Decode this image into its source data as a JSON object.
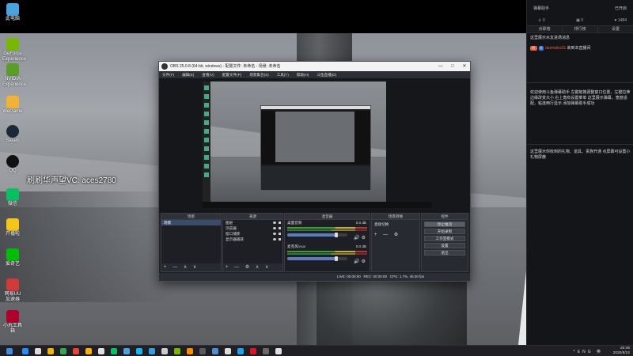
{
  "desktop": {
    "icons": [
      {
        "label": "此电脑",
        "color": "#4aa3df"
      },
      {
        "label": "GeForce Experience",
        "color": "#76b900"
      },
      {
        "label": "NVIDIA Experience",
        "color": "#5a9e2a"
      },
      {
        "label": "WeGame",
        "color": "#f2b233"
      },
      {
        "label": "Steam",
        "color": "#1b2838"
      },
      {
        "label": "QQ",
        "color": "#111111"
      },
      {
        "label": "微信",
        "color": "#07c160"
      },
      {
        "label": "开播啦",
        "color": "#f5c518"
      },
      {
        "label": "爱奇艺",
        "color": "#00be06"
      },
      {
        "label": "网易UU加速器",
        "color": "#d23a3a"
      },
      {
        "label": "小丸工具箱",
        "color": "#b0002a"
      }
    ],
    "overlay_text": "刷刷华声望VC: aces2780"
  },
  "side_panel": {
    "title": "弹幕助手",
    "status": "已开启",
    "stats": [
      {
        "icon": "person-icon",
        "value": "0"
      },
      {
        "icon": "gift-icon",
        "value": "0"
      },
      {
        "icon": "heart-icon",
        "value": "1484"
      }
    ],
    "tabs": [
      "点歌墙",
      "排行榜",
      "设置"
    ],
    "messages": [
      {
        "text": "这里展示水友进场消息"
      },
      {
        "badges": [
          "粉",
          "8"
        ],
        "user": "danmaku01",
        "text": "来到本直播间"
      },
      {
        "text": "欢迎使用斗鱼弹幕助手 左键拖拽调整窗口位置，左键拉伸边缘改变大小 右上角有设置菜单 这里展示弹幕，宽度适配，粘连两行显示 添加弹幕助手成功"
      },
      {
        "text": "这里展示你收到的礼物、道具、贵族开通 点屏幕可设置小礼物屏蔽"
      }
    ]
  },
  "obs": {
    "title": "OBS 25.0.8 (64-bit, windows) - 配置文件: 未命名 - 场景: 未命名",
    "window_buttons": [
      "—",
      "□",
      "✕"
    ],
    "menu": [
      "文件(F)",
      "编辑(E)",
      "查看(V)",
      "配置文件(P)",
      "场景集合(S)",
      "工具(T)",
      "帮助(H)",
      "斗鱼直播(D)"
    ],
    "docks": {
      "scenes": {
        "title": "场景",
        "items": [
          "场景"
        ],
        "footer": "+ — ∧ ∨"
      },
      "sources": {
        "title": "来源",
        "items": [
          "图层",
          "浏览器",
          "窗口捕获",
          "显示器捕获"
        ],
        "footer": "+ — ⚙ ∧ ∨"
      },
      "mixer": {
        "title": "混音器",
        "channels": [
          {
            "name": "桌面音频",
            "db": "0.0 dB",
            "level": 0.82
          },
          {
            "name": "麦克风/Aux",
            "db": "0.0 dB",
            "level": 0.82
          }
        ]
      },
      "transitions": {
        "title": "场景转换",
        "type": "直接切换",
        "footer": "+ — ⚙"
      },
      "controls": {
        "title": "控件",
        "buttons": [
          "停止推流",
          "开始录制",
          "工作室模式",
          "设置",
          "退出"
        ]
      }
    },
    "status_bar": {
      "live": "LIVE: 00:00:00",
      "rec": "REC: 00:00:00",
      "cpu": "CPU: 1.7%, 45.00 fps"
    }
  },
  "taskbar": {
    "pinned_colors": [
      "#1e90ff",
      "#dddddd",
      "#f4b400",
      "#34a853",
      "#ea4335",
      "#ffb300",
      "#e0e0e0",
      "#07c160",
      "#4aa3df",
      "#12b7f5",
      "#2f9fe8",
      "#cccccc",
      "#76b900",
      "#ff8c00",
      "#5b5b5b",
      "#4a8fd8",
      "#dddddd",
      "#1da1f2",
      "#e81123",
      "#6a6a6a",
      "#e0e0e0"
    ],
    "tray_text": "ENG 英",
    "time": "20:46",
    "date": "2020/8/22"
  }
}
